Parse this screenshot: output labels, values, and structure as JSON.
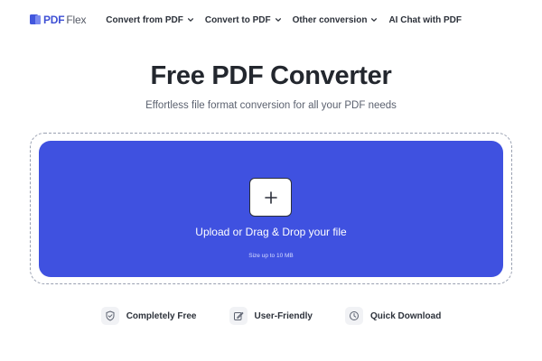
{
  "brand": {
    "name_bold": "PDF",
    "name_light": "Flex"
  },
  "nav": {
    "items": [
      {
        "label": "Convert from PDF",
        "has_dropdown": true
      },
      {
        "label": "Convert to PDF",
        "has_dropdown": true
      },
      {
        "label": "Other conversion",
        "has_dropdown": true
      },
      {
        "label": "AI Chat with PDF",
        "has_dropdown": false
      }
    ]
  },
  "hero": {
    "title": "Free PDF Converter",
    "subtitle": "Effortless file format conversion for all your PDF needs"
  },
  "upload": {
    "button_icon": "plus-icon",
    "label": "Upload or Drag & Drop your file",
    "size_note": "Size up to 10 MB"
  },
  "features": [
    {
      "icon": "shield-check-icon",
      "label": "Completely Free"
    },
    {
      "icon": "edit-icon",
      "label": "User-Friendly"
    },
    {
      "icon": "clock-icon",
      "label": "Quick Download"
    }
  ],
  "colors": {
    "accent": "#3f51e0",
    "brand": "#3e50d4",
    "text": "#23272e",
    "muted": "#5c6270"
  }
}
